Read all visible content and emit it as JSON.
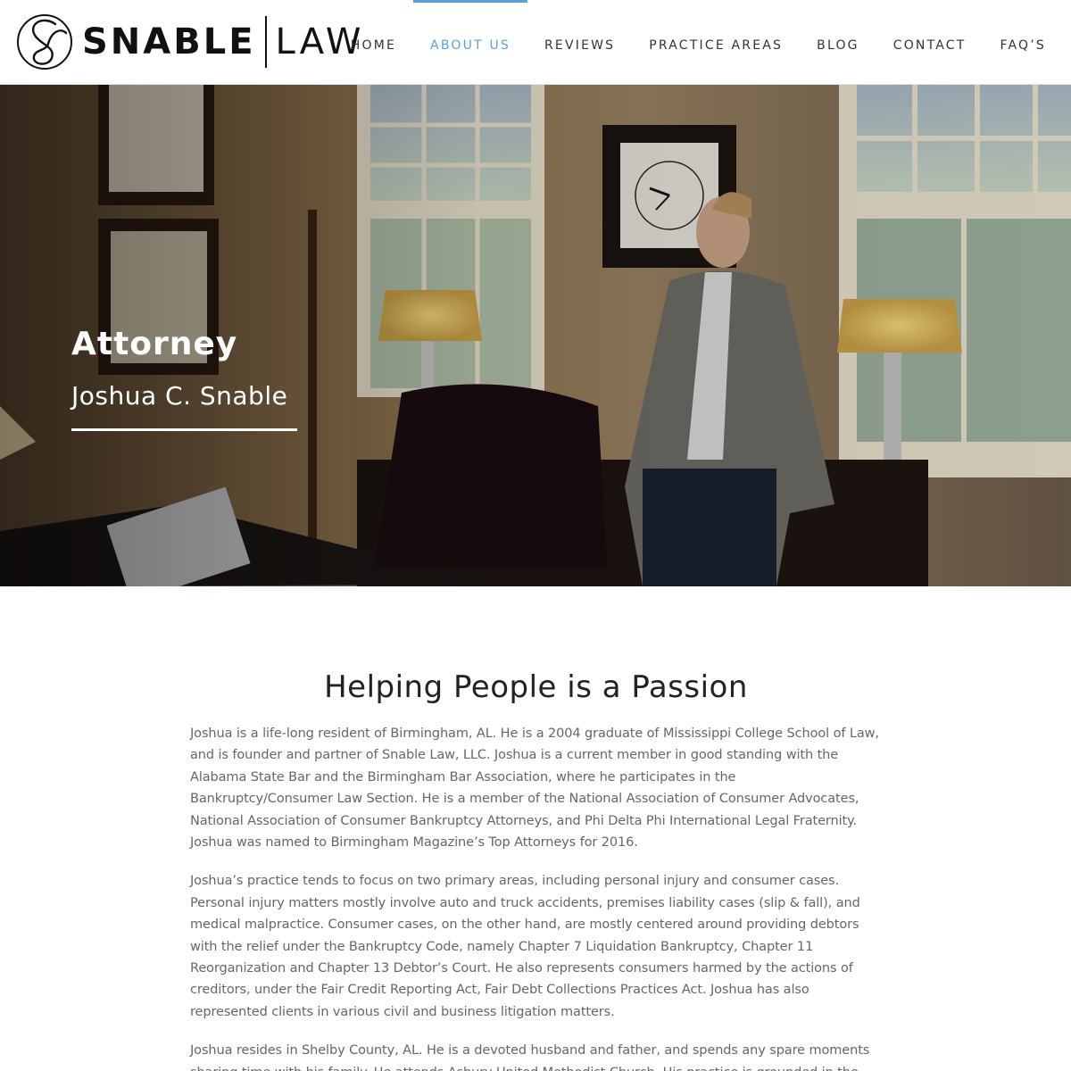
{
  "brand": {
    "name": "SNABLE",
    "suffix": "LAW"
  },
  "nav": {
    "items": [
      {
        "label": "HOME"
      },
      {
        "label": "ABOUT US"
      },
      {
        "label": "REVIEWS"
      },
      {
        "label": "PRACTICE AREAS"
      },
      {
        "label": "BLOG"
      },
      {
        "label": "CONTACT"
      },
      {
        "label": "FAQ’S"
      }
    ],
    "active": "ABOUT US"
  },
  "hero": {
    "title": "Attorney",
    "subtitle": "Joshua C. Snable"
  },
  "main": {
    "heading": "Helping People is a Passion",
    "paragraphs": [
      "Joshua is a life-long resident of Birmingham, AL. He is a 2004 graduate of Mississippi College School of Law, and is founder and partner of Snable Law, LLC. Joshua is a current member in good standing with the Alabama State Bar and the Birmingham Bar Association, where he participates in the Bankruptcy/Consumer Law Section. He is a member of the National Association of Consumer Advocates, National Association of Consumer Bankruptcy Attorneys, and Phi Delta Phi International Legal Fraternity. Joshua was named to Birmingham Magazine’s Top Attorneys for 2016.",
      "Joshua’s practice tends to focus on two primary areas, including personal injury and consumer cases.  Personal injury matters mostly involve auto and truck accidents, premises liability cases (slip & fall), and medical malpractice.  Consumer cases, on the other hand, are mostly centered around providing debtors with the relief under the Bankruptcy Code, namely Chapter 7 Liquidation Bankruptcy, Chapter 11 Reorganization and Chapter 13 Debtor’s Court. He also represents consumers harmed by the actions of creditors, under the Fair Credit Reporting Act, Fair Debt Collections Practices Act. Joshua has also represented clients in various civil and business litigation matters.",
      "Joshua resides in Shelby County, AL. He is a devoted husband and father, and spends any spare moments sharing time with his family. He attends Asbury United Methodist Church. His practice is grounded in the proverb, “Plans"
    ]
  },
  "colors": {
    "accent": "#5aa0e0",
    "text": "#666666",
    "heading": "#222222"
  }
}
